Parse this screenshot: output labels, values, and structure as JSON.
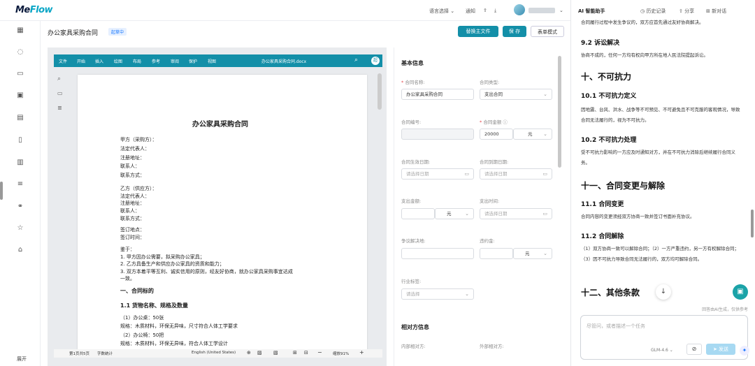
{
  "app": {
    "logo_a": "Me",
    "logo_b": "Flow"
  },
  "topbar": {
    "language": "语言选择 ⌄",
    "notify": "通知"
  },
  "sidebar": {
    "expand": "展开"
  },
  "doc": {
    "title": "办公家具采购合同",
    "status": "起草中"
  },
  "actions": {
    "replace": "替换主文件",
    "save": "保 存",
    "form_mode": "表单模式"
  },
  "ribbon": {
    "menus": [
      "文件",
      "开始",
      "插入",
      "绘图",
      "布局",
      "参考",
      "审阅",
      "保护",
      "视图"
    ],
    "filename": "办公家具采购合同.docx",
    "avatar": "超"
  },
  "paper": {
    "title": "办公家具采购合同",
    "lines": [
      "甲方（采购方）：",
      "法定代表人：",
      "注册地址：",
      "联系人：",
      "联系方式：",
      "乙方（供应方）：",
      "法定代表人：",
      "注册地址：",
      "联系人：",
      "联系方式：",
      "签订地点：",
      "签订时间：",
      "鉴于：",
      "1. 甲方因办公需要，拟采购办公家具；",
      "2. 乙方具备生产和供应办公家具的资质和能力；",
      "3. 双方本着平等互利、诚实信用的原则，经友好协商，就办公家具采购事宜达成",
      "一致。"
    ],
    "h1": "一、合同标的",
    "h2": "1.1 货物名称、规格及数量",
    "items": [
      "（1）办公桌：50张",
      "规格：木质材料，环保无异味，尺寸符合人体工学要求",
      "（2）办公椅：50把",
      "规格：木质材料，环保无异味，符合人体工学设计"
    ]
  },
  "statusbar": {
    "page": "第1页共5页",
    "wordcount": "字数统计",
    "lang": "English (United States)",
    "zoom": "缩放91%"
  },
  "form": {
    "section1": "基本信息",
    "name_label": "合同名称:",
    "name_value": "办公家具采购合同",
    "type_label": "合同类型:",
    "type_value": "支出合同",
    "number_label": "合同编号:",
    "amount_label": "合同金额",
    "amount_value": "20000",
    "amount_unit": "元",
    "start_label": "合同生效日期:",
    "start_ph": "请选择日期",
    "end_label": "合同到期日期:",
    "end_ph": "请选择日期",
    "pay_label": "支出金额:",
    "pay_unit": "元",
    "paytime_label": "支出时间:",
    "paytime_ph": "请选择日期",
    "dispute_label": "争议解决地:",
    "penalty_label": "违约金:",
    "penalty_unit": "元",
    "industry_label": "行业标签:",
    "industry_ph": "请选择",
    "section2": "相对方信息",
    "internal_label": "内部相对方:",
    "external_label": "外部相对方:"
  },
  "ai": {
    "title": "AI 智能助手",
    "history": "历史记录",
    "share": "分享",
    "new_chat": "新对话",
    "p0": "合同履行过程中发生争议的，双方应首先通过友好协商解决。",
    "h92": "9.2 诉讼解决",
    "p92": "协商不成的，任何一方均有权向甲方所在地人民法院提起诉讼。",
    "h10": "十、不可抗力",
    "h101": "10.1 不可抗力定义",
    "p101": "因地震、台风、洪水、战争等不可预见、不可避免且不可克服的客观情况，导致合同无法履行的，视为不可抗力。",
    "h102": "10.2 不可抗力处理",
    "p102": "受不可抗力影响的一方应及时通知对方，并在不可抗力消除后继续履行合同义务。",
    "h11": "十一、合同变更与解除",
    "h111": "11.1 合同变更",
    "p111": "合同内容的变更须经双方协商一致并签订书面补充协议。",
    "h112": "11.2 合同解除",
    "p112": "（1）双方协商一致可以解除合同；（2）一方严重违约，另一方有权解除合同；（3）因不可抗力导致合同无法履行的，双方均可解除合同。",
    "h12": "十二、其他条款",
    "note": "回答由AI生成，仅供参考",
    "input_ph": "尽管问，或者描述一个任务",
    "model": "GLM-4.6 ⌄",
    "send": "发送"
  }
}
